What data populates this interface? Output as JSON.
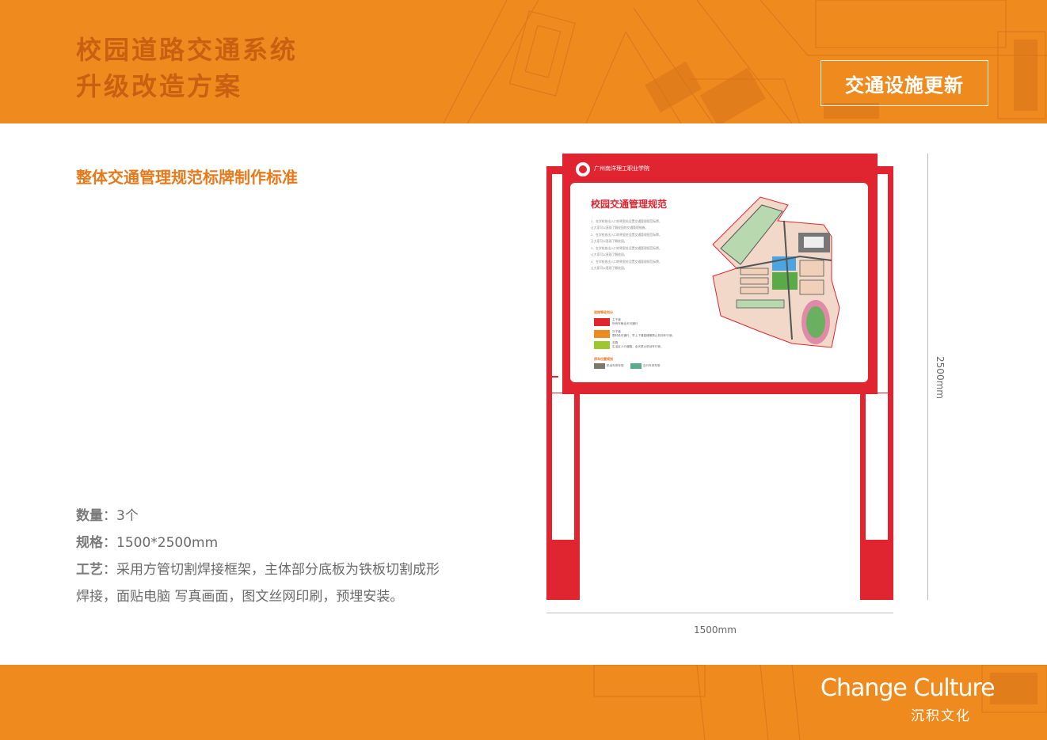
{
  "header": {
    "title_line1": "校园道路交通系统",
    "title_line2": "升级改造方案",
    "badge": "交通设施更新"
  },
  "section": {
    "subtitle": "整体交通管理规范标牌制作标准"
  },
  "specs": {
    "quantity_label": "数量",
    "quantity_value": "：3个",
    "size_label": "规格",
    "size_value": "：1500*2500mm",
    "craft_label": "工艺",
    "craft_value_line1": "：采用方管切割焊接框架，主体部分底板为铁板切割成形",
    "craft_value_line2": "焊接，面贴电脑 写真画面，图文丝网印刷，预埋安装。"
  },
  "sign": {
    "school_name": "广州南洋理工职业学院",
    "board_title": "校园交通管理规范",
    "rules": [
      "1、在学校各出入口的明显处设置交通管理规范标牌，",
      "让大家可以直观了解校园的交通管理措施。",
      "2、在学校各出入口的明显处设置交通管理规范标牌，",
      "让大家可以直观了解校园。",
      "3、在学校各出入口的明显处设置交通管理规范标牌，",
      "让大家可以直观了解校园。",
      "4、在学校各出入口的明显处设置交通管理规范标牌，",
      "让大家可以直观了解校园。"
    ],
    "legend_title": "道路等级划分",
    "legend": [
      {
        "name": "主干道",
        "desc": "所有车辆全天可通行",
        "color": "#e02430"
      },
      {
        "name": "次干道",
        "desc": "限时段可通行，早上下课高峰期禁止机动车行驶。",
        "color": "#ef8a1e"
      },
      {
        "name": "支路",
        "desc": "生活区人行道路，全天禁止机动车行驶。",
        "color": "#9dc72f"
      }
    ],
    "parking_title": "停车位置规划",
    "parking": [
      {
        "name": "机动车停车带",
        "color": "#7d786c"
      },
      {
        "name": "自行车停车带",
        "color": "#5aaa8c"
      }
    ]
  },
  "dimensions": {
    "width": "1500mm",
    "height": "2500mm"
  },
  "brand": {
    "english": "Change Culture",
    "chinese": "沉积文化"
  },
  "colors": {
    "orange": "#ef8a1e",
    "red": "#e02430",
    "title_brown": "#c95f10"
  }
}
